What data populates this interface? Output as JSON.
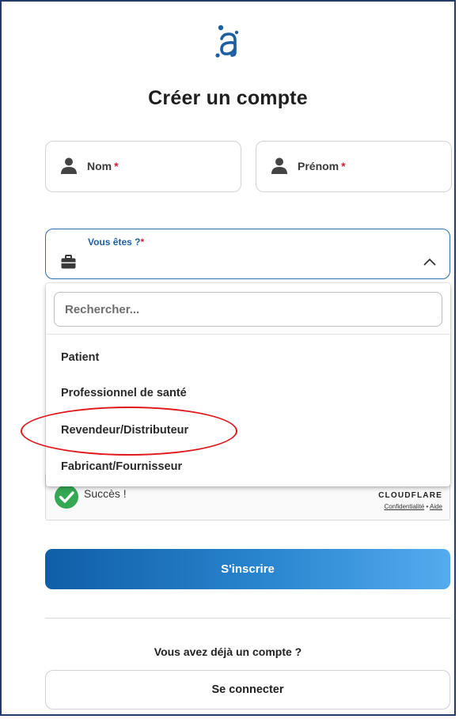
{
  "icons": {
    "logo": "logo-a-icon",
    "person": "person-icon",
    "briefcase": "briefcase-icon",
    "chevron": "chevron-up-icon",
    "check": "check-circle-icon"
  },
  "colors": {
    "primary": "#1f6db8",
    "accent_blue": "#1d5fa3",
    "required": "#d21f3c",
    "success": "#34a853",
    "highlight_circle": "#e0161b"
  },
  "page": {
    "title": "Créer un compte"
  },
  "form": {
    "nom": {
      "label": "Nom",
      "required_mark": "*"
    },
    "prenom": {
      "label": "Prénom",
      "required_mark": "*"
    },
    "role": {
      "label": "Vous êtes ?",
      "required_mark": "*",
      "search_placeholder": "Rechercher...",
      "options": [
        "Patient",
        "Professionnel de santé",
        "Revendeur/Distributeur",
        "Fabricant/Fournisseur"
      ]
    }
  },
  "captcha": {
    "status": "Succès !",
    "brand": "CLOUDFLARE",
    "privacy": "Confidentialité",
    "separator": "•",
    "help": "Aide"
  },
  "actions": {
    "signup_label": "S'inscrire",
    "already_text": "Vous avez déjà un compte ?",
    "login_label": "Se connecter"
  }
}
